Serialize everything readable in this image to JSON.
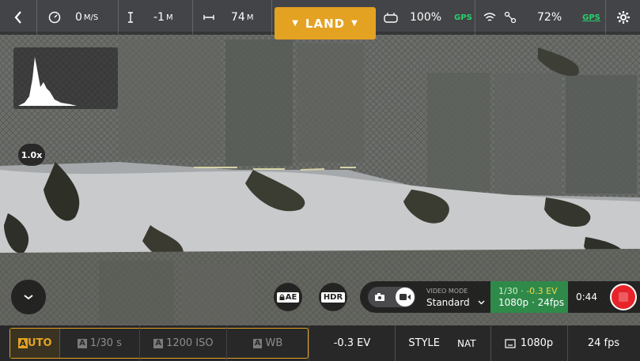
{
  "top_bar": {
    "back": "<",
    "speed_value": "0",
    "speed_unit": "M/S",
    "altitude_value": "-1",
    "altitude_unit": "M",
    "distance_value": "74",
    "distance_unit": "M",
    "land_label": "LAND",
    "controller_battery": "100%",
    "controller_gps": "GPS",
    "drone_battery": "72%",
    "drone_gps": "GPS"
  },
  "zoom": "1.0x",
  "controls": {
    "ae_lock": "AE",
    "hdr": "HDR"
  },
  "video_mode": {
    "label": "VIDEO MODE",
    "value": "Standard"
  },
  "exposure_info": {
    "shutter": "1/30",
    "ev": "-0.3 EV",
    "resolution_fps": "1080p · 24fps"
  },
  "record_time": "0:44",
  "bottom_bar": {
    "auto_badge": "A",
    "auto_rest": "UTO",
    "shutter_badge": "A",
    "shutter": "1/30 s",
    "iso_badge": "A",
    "iso": "1200 ISO",
    "wb_badge": "A",
    "wb": "WB",
    "ev": "-0.3 EV",
    "style": "STYLE",
    "style_value": "NAT",
    "resolution": "1080p",
    "fps": "24 fps"
  },
  "colors": {
    "accent": "#e4a223",
    "gps_green": "#22d36a",
    "info_green": "#2f8a4a",
    "record_red": "#e8242b"
  },
  "icons": [
    "back-icon",
    "speedometer-icon",
    "altitude-icon",
    "distance-icon",
    "land-chevron-icon",
    "controller-icon",
    "wifi-icon",
    "drone-icon",
    "settings-icon",
    "collapse-chevron-icon",
    "lock-icon",
    "photo-icon",
    "video-icon",
    "dropdown-chevron-icon",
    "record-icon",
    "aspect-ratio-icon"
  ]
}
